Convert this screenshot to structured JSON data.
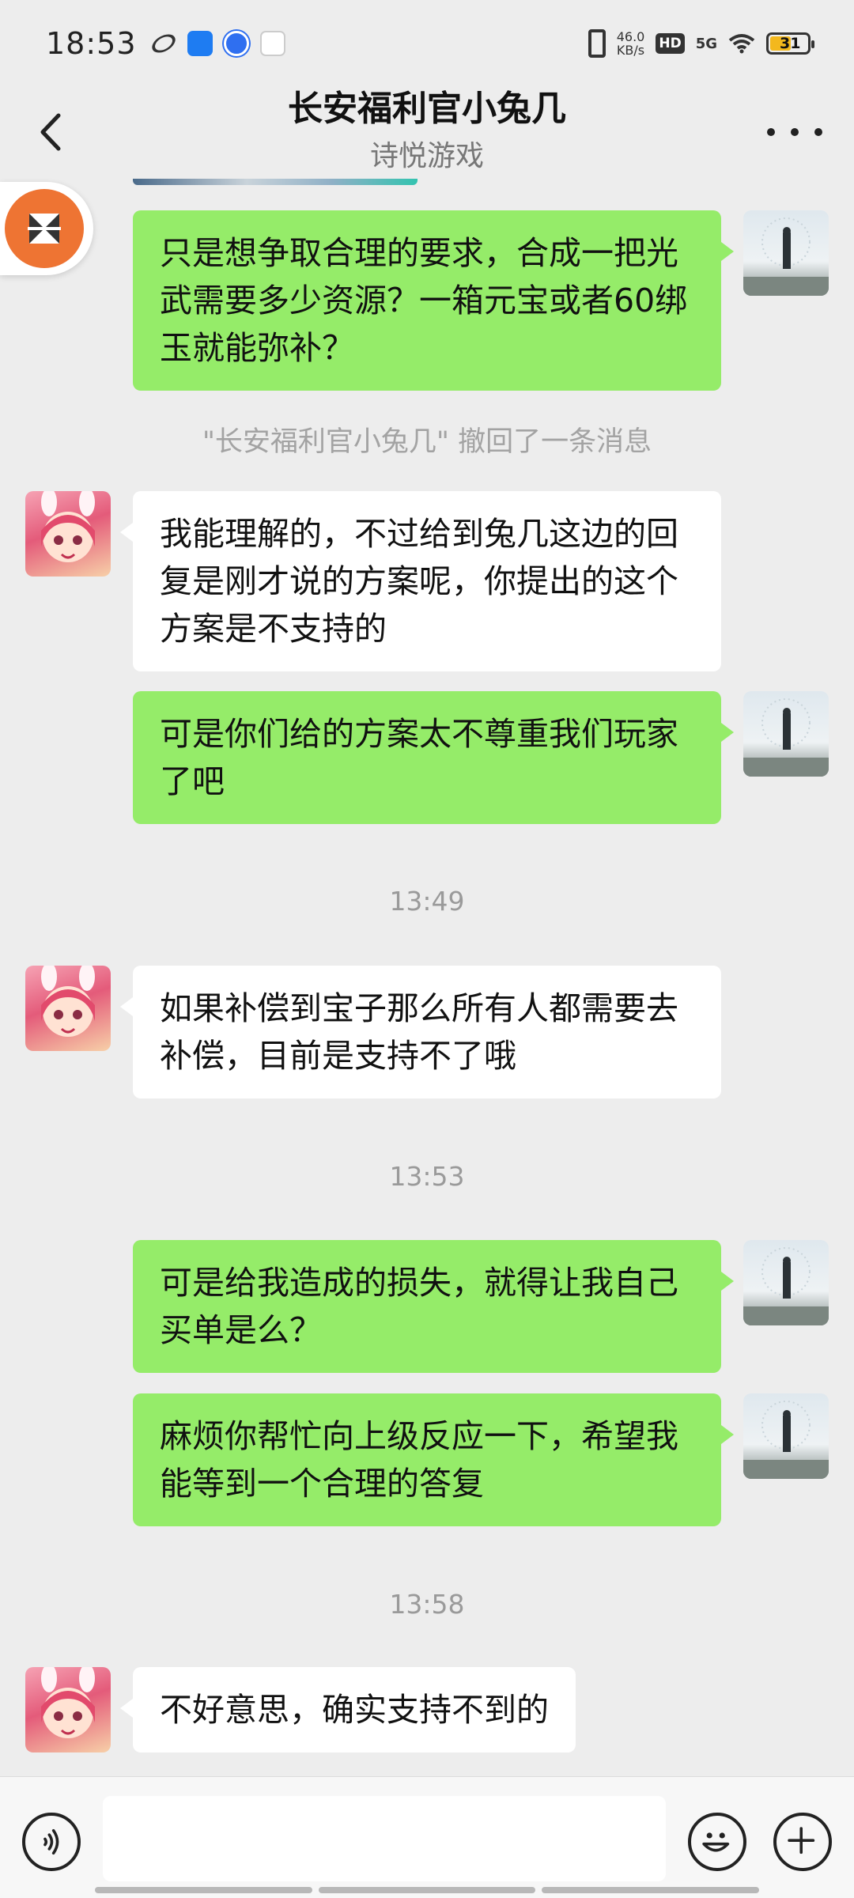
{
  "status_bar": {
    "time": "18:53",
    "net_speed_value": "46.0",
    "net_speed_unit": "KB/s",
    "hd_label": "HD",
    "network": "5G",
    "battery": "31",
    "battery_color": "#f3b81d"
  },
  "header": {
    "title": "长安福利官小兔几",
    "subtitle": "诗悦游戏"
  },
  "messages": [
    {
      "type": "text",
      "from": "me",
      "text": "只是想争取合理的要求，合成一把光武需要多少资源？一箱元宝或者60绑玉就能弥补？"
    },
    {
      "type": "system",
      "text": "\"长安福利官小兔几\" 撤回了一条消息"
    },
    {
      "type": "text",
      "from": "other",
      "text": "我能理解的，不过给到兔几这边的回复是刚才说的方案呢，你提出的这个方案是不支持的"
    },
    {
      "type": "text",
      "from": "me",
      "text": "可是你们给的方案太不尊重我们玩家了吧"
    },
    {
      "type": "time",
      "text": "13:49"
    },
    {
      "type": "text",
      "from": "other",
      "text": "如果补偿到宝子那么所有人都需要去补偿，目前是支持不了哦"
    },
    {
      "type": "time",
      "text": "13:53"
    },
    {
      "type": "text",
      "from": "me",
      "text": "可是给我造成的损失，就得让我自己买单是么？"
    },
    {
      "type": "text",
      "from": "me",
      "text": "麻烦你帮忙向上级反应一下，希望我能等到一个合理的答复"
    },
    {
      "type": "time",
      "text": "13:58"
    },
    {
      "type": "text",
      "from": "other",
      "text": "不好意思，确实支持不到的"
    }
  ],
  "colors": {
    "my_bubble": "#95ec69",
    "other_bubble": "#ffffff",
    "background": "#ededed",
    "float_badge": "#ee7433"
  },
  "icons": {
    "back": "chevron-left-icon",
    "more": "more-dots-icon",
    "voice": "voice-icon",
    "emoji": "emoji-icon",
    "plus": "plus-icon"
  }
}
